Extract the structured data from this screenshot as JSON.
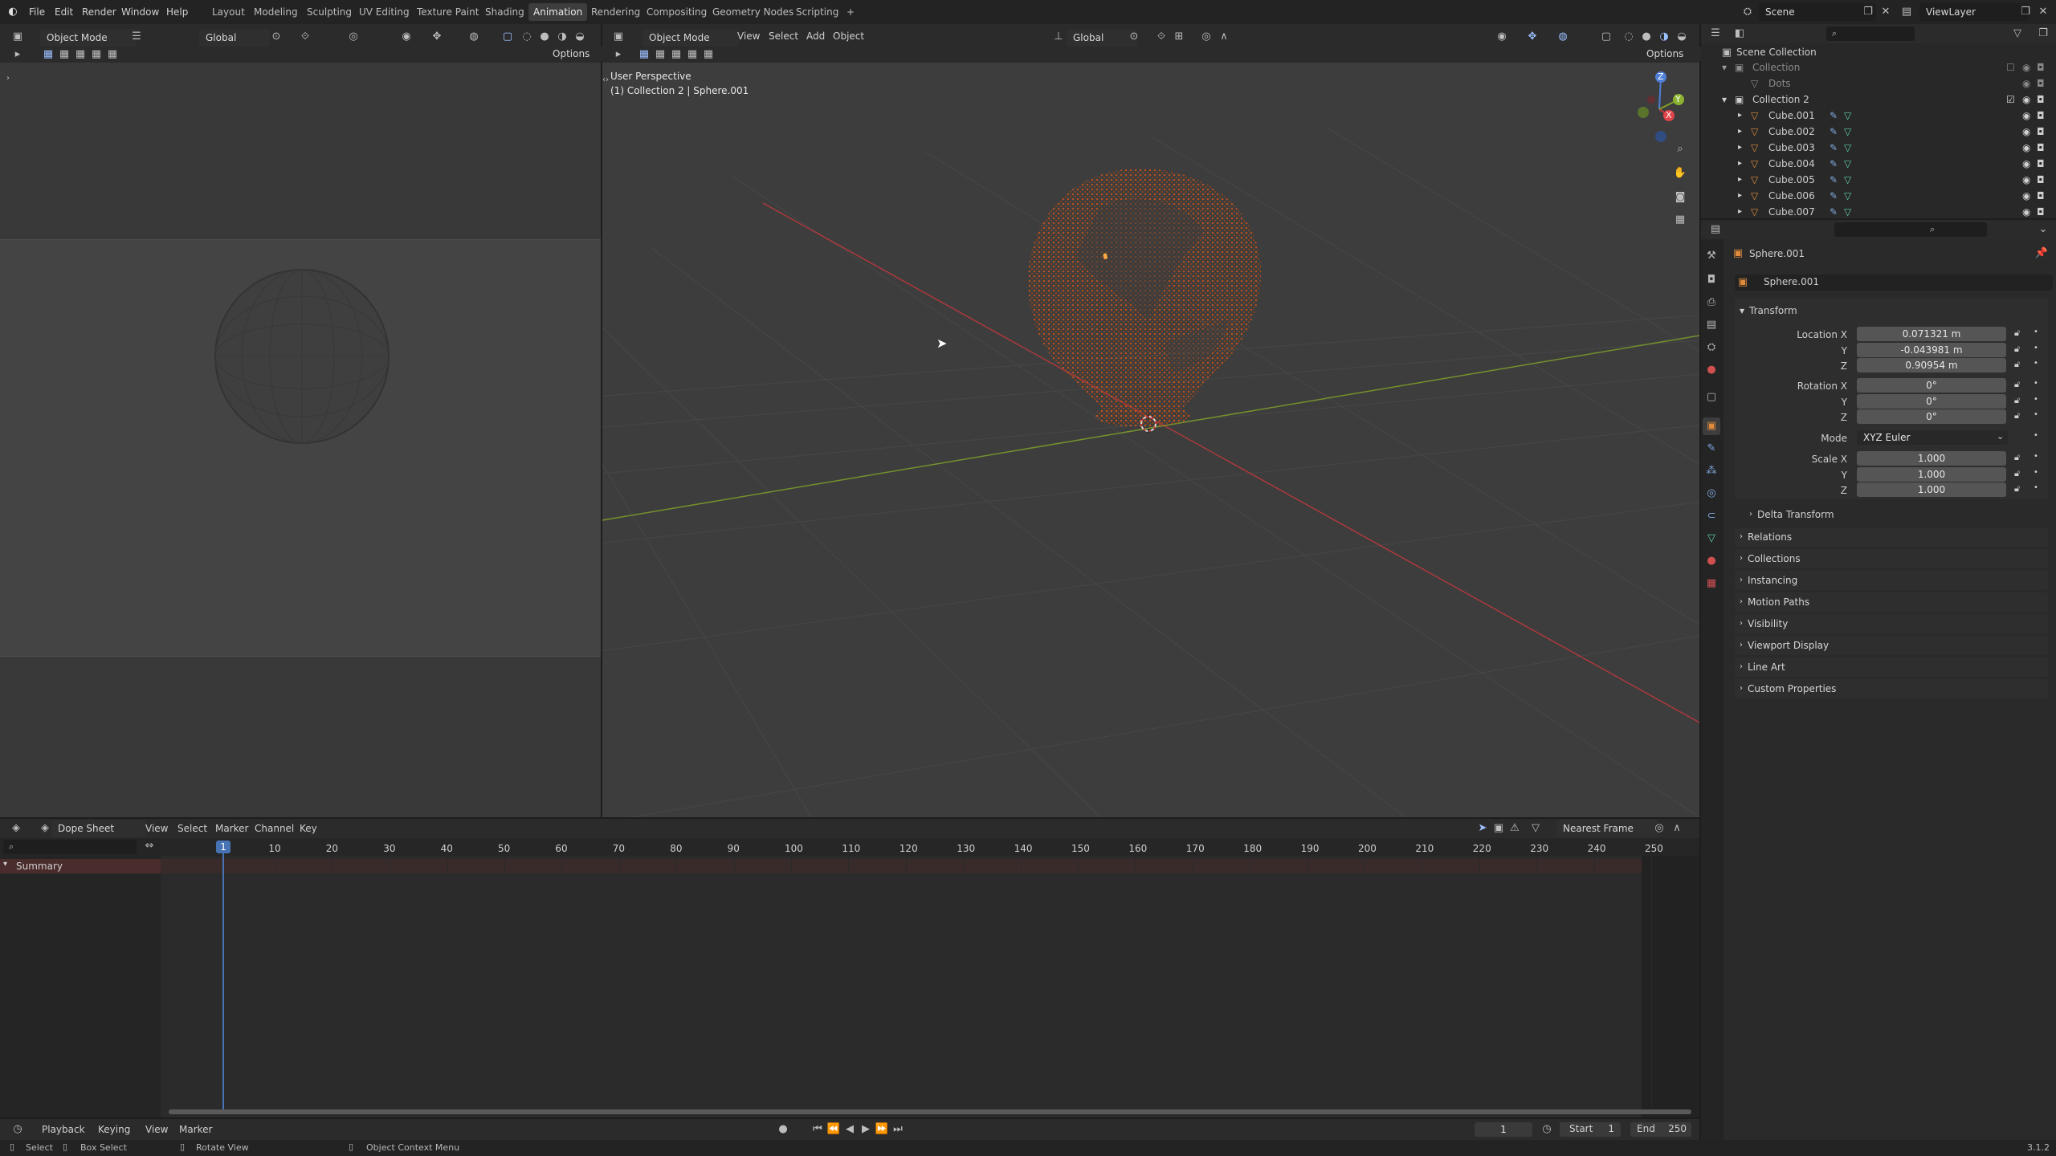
{
  "menu": {
    "items": [
      "File",
      "Edit",
      "Render",
      "Window",
      "Help"
    ],
    "workspaces": [
      "Layout",
      "Modeling",
      "Sculpting",
      "UV Editing",
      "Texture Paint",
      "Shading",
      "Animation",
      "Rendering",
      "Compositing",
      "Geometry Nodes",
      "Scripting"
    ],
    "active_workspace": "Animation",
    "add_tab": "+",
    "scene": "Scene",
    "view_layer": "ViewLayer"
  },
  "left_viewport": {
    "mode": "Object Mode",
    "orientation": "Global",
    "options": "Options"
  },
  "main_viewport": {
    "mode": "Object Mode",
    "menu": [
      "View",
      "Select",
      "Add",
      "Object"
    ],
    "orientation": "Global",
    "options": "Options",
    "overlay_title": "User Perspective",
    "overlay_subtitle": "(1) Collection 2 | Sphere.001",
    "gizmo_labels": [
      "Z",
      "X",
      "Y"
    ]
  },
  "outliner": {
    "root": "Scene Collection",
    "rows": [
      {
        "label": "Collection",
        "muted": true
      },
      {
        "label": "Dots",
        "muted": true
      },
      {
        "label": "Collection 2",
        "muted": false
      },
      {
        "label": "Cube.001",
        "muted": false
      },
      {
        "label": "Cube.002",
        "muted": false
      },
      {
        "label": "Cube.003",
        "muted": false
      },
      {
        "label": "Cube.004",
        "muted": false
      },
      {
        "label": "Cube.005",
        "muted": false
      },
      {
        "label": "Cube.006",
        "muted": false
      },
      {
        "label": "Cube.007",
        "muted": false
      }
    ]
  },
  "properties": {
    "object_name": "Sphere.001",
    "datablock_name": "Sphere.001",
    "transform_header": "Transform",
    "location_label": "Location X",
    "location": [
      "0.071321 m",
      "-0.043981 m",
      "0.90954 m"
    ],
    "rotation_label": "Rotation X",
    "rotation": [
      "0°",
      "0°",
      "0°"
    ],
    "mode_label": "Mode",
    "mode_value": "XYZ Euler",
    "scale_label": "Scale X",
    "scale": [
      "1.000",
      "1.000",
      "1.000"
    ],
    "axis_y": "Y",
    "axis_z": "Z",
    "delta_transform": "Delta Transform",
    "panels": [
      "Relations",
      "Collections",
      "Instancing",
      "Motion Paths",
      "Visibility",
      "Viewport Display",
      "Line Art",
      "Custom Properties"
    ]
  },
  "dopesheet": {
    "editor": "Dope Sheet",
    "menu": [
      "View",
      "Select",
      "Marker",
      "Channel",
      "Key"
    ],
    "snapping": "Nearest Frame",
    "summary": "Summary",
    "ticks": [
      "1",
      "10",
      "20",
      "30",
      "40",
      "50",
      "60",
      "70",
      "80",
      "90",
      "100",
      "110",
      "120",
      "130",
      "140",
      "150",
      "160",
      "170",
      "180",
      "190",
      "200",
      "210",
      "220",
      "230",
      "240",
      "250"
    ],
    "tick_values": [
      1,
      10,
      20,
      30,
      40,
      50,
      60,
      70,
      80,
      90,
      100,
      110,
      120,
      130,
      140,
      150,
      160,
      170,
      180,
      190,
      200,
      210,
      220,
      230,
      240,
      250
    ],
    "current_frame": 1
  },
  "timeline": {
    "menu": [
      "Playback",
      "Keying",
      "View",
      "Marker"
    ],
    "frame": "1",
    "start_label": "Start",
    "start": "1",
    "end_label": "End",
    "end": "250"
  },
  "status": {
    "select": "Select",
    "box_select": "Box Select",
    "rotate_view": "Rotate View",
    "context_menu": "Object Context Menu",
    "version": "3.1.2"
  },
  "colors": {
    "accent": "#4772b3",
    "particles": "#c0521c",
    "x_axis": "#c0393e",
    "y_axis": "#7fa02a"
  }
}
